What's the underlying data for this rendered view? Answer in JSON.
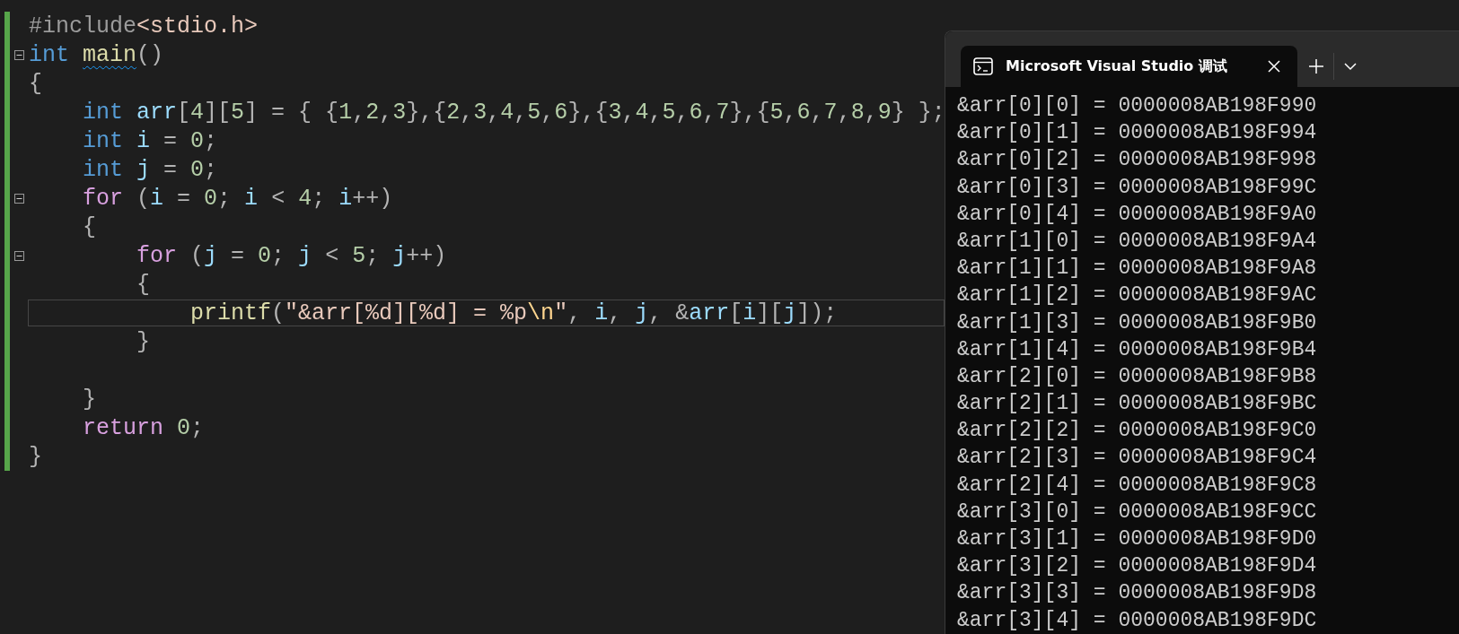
{
  "editor": {
    "lines": [
      {
        "tokens": [
          {
            "t": "#include",
            "kind": "pre"
          },
          {
            "t": "<stdio.h>",
            "kind": "inc"
          }
        ]
      },
      {
        "expanded": true,
        "tokens": [
          {
            "t": "int ",
            "kind": "kw"
          },
          {
            "t": "main",
            "kind": "fn",
            "error": true
          },
          {
            "t": "()",
            "kind": "p"
          }
        ]
      },
      {
        "tokens": [
          {
            "t": "{",
            "kind": "p"
          }
        ]
      },
      {
        "tokens": [
          {
            "t": "    int ",
            "kind": "kw"
          },
          {
            "t": "arr",
            "kind": "var"
          },
          {
            "t": "[",
            "kind": "p"
          },
          {
            "t": "4",
            "kind": "num"
          },
          {
            "t": "][",
            "kind": "p"
          },
          {
            "t": "5",
            "kind": "num"
          },
          {
            "t": "] = { {",
            "kind": "p"
          },
          {
            "t": "1",
            "kind": "num"
          },
          {
            "t": ",",
            "kind": "p"
          },
          {
            "t": "2",
            "kind": "num"
          },
          {
            "t": ",",
            "kind": "p"
          },
          {
            "t": "3",
            "kind": "num"
          },
          {
            "t": "},{",
            "kind": "p"
          },
          {
            "t": "2",
            "kind": "num"
          },
          {
            "t": ",",
            "kind": "p"
          },
          {
            "t": "3",
            "kind": "num"
          },
          {
            "t": ",",
            "kind": "p"
          },
          {
            "t": "4",
            "kind": "num"
          },
          {
            "t": ",",
            "kind": "p"
          },
          {
            "t": "5",
            "kind": "num"
          },
          {
            "t": ",",
            "kind": "p"
          },
          {
            "t": "6",
            "kind": "num"
          },
          {
            "t": "},{",
            "kind": "p"
          },
          {
            "t": "3",
            "kind": "num"
          },
          {
            "t": ",",
            "kind": "p"
          },
          {
            "t": "4",
            "kind": "num"
          },
          {
            "t": ",",
            "kind": "p"
          },
          {
            "t": "5",
            "kind": "num"
          },
          {
            "t": ",",
            "kind": "p"
          },
          {
            "t": "6",
            "kind": "num"
          },
          {
            "t": ",",
            "kind": "p"
          },
          {
            "t": "7",
            "kind": "num"
          },
          {
            "t": "},{",
            "kind": "p"
          },
          {
            "t": "5",
            "kind": "num"
          },
          {
            "t": ",",
            "kind": "p"
          },
          {
            "t": "6",
            "kind": "num"
          },
          {
            "t": ",",
            "kind": "p"
          },
          {
            "t": "7",
            "kind": "num"
          },
          {
            "t": ",",
            "kind": "p"
          },
          {
            "t": "8",
            "kind": "num"
          },
          {
            "t": ",",
            "kind": "p"
          },
          {
            "t": "9",
            "kind": "num"
          },
          {
            "t": "} };",
            "kind": "p"
          }
        ]
      },
      {
        "tokens": [
          {
            "t": "    int ",
            "kind": "kw"
          },
          {
            "t": "i",
            "kind": "var"
          },
          {
            "t": " = ",
            "kind": "p"
          },
          {
            "t": "0",
            "kind": "num"
          },
          {
            "t": ";",
            "kind": "p"
          }
        ]
      },
      {
        "tokens": [
          {
            "t": "    int ",
            "kind": "kw"
          },
          {
            "t": "j",
            "kind": "var"
          },
          {
            "t": " = ",
            "kind": "p"
          },
          {
            "t": "0",
            "kind": "num"
          },
          {
            "t": ";",
            "kind": "p"
          }
        ]
      },
      {
        "expanded": true,
        "tokens": [
          {
            "t": "    for",
            "kind": "ctl"
          },
          {
            "t": " (",
            "kind": "p"
          },
          {
            "t": "i",
            "kind": "var"
          },
          {
            "t": " = ",
            "kind": "p"
          },
          {
            "t": "0",
            "kind": "num"
          },
          {
            "t": "; ",
            "kind": "p"
          },
          {
            "t": "i",
            "kind": "var"
          },
          {
            "t": " < ",
            "kind": "p"
          },
          {
            "t": "4",
            "kind": "num"
          },
          {
            "t": "; ",
            "kind": "p"
          },
          {
            "t": "i",
            "kind": "var"
          },
          {
            "t": "++)",
            "kind": "p"
          }
        ]
      },
      {
        "tokens": [
          {
            "t": "    {",
            "kind": "p"
          }
        ]
      },
      {
        "expanded": true,
        "tokens": [
          {
            "t": "        for",
            "kind": "ctl"
          },
          {
            "t": " (",
            "kind": "p"
          },
          {
            "t": "j",
            "kind": "var"
          },
          {
            "t": " = ",
            "kind": "p"
          },
          {
            "t": "0",
            "kind": "num"
          },
          {
            "t": "; ",
            "kind": "p"
          },
          {
            "t": "j",
            "kind": "var"
          },
          {
            "t": " < ",
            "kind": "p"
          },
          {
            "t": "5",
            "kind": "num"
          },
          {
            "t": "; ",
            "kind": "p"
          },
          {
            "t": "j",
            "kind": "var"
          },
          {
            "t": "++)",
            "kind": "p"
          }
        ]
      },
      {
        "tokens": [
          {
            "t": "        {",
            "kind": "p"
          }
        ]
      },
      {
        "current": true,
        "tokens": [
          {
            "t": "            printf",
            "kind": "fn"
          },
          {
            "t": "(",
            "kind": "p"
          },
          {
            "t": "\"&arr[%d][%d] = %p",
            "kind": "str"
          },
          {
            "t": "\\n",
            "kind": "esc"
          },
          {
            "t": "\"",
            "kind": "str"
          },
          {
            "t": ", ",
            "kind": "p"
          },
          {
            "t": "i",
            "kind": "var"
          },
          {
            "t": ", ",
            "kind": "p"
          },
          {
            "t": "j",
            "kind": "var"
          },
          {
            "t": ", &",
            "kind": "p"
          },
          {
            "t": "arr",
            "kind": "var"
          },
          {
            "t": "[",
            "kind": "p"
          },
          {
            "t": "i",
            "kind": "var"
          },
          {
            "t": "][",
            "kind": "p"
          },
          {
            "t": "j",
            "kind": "var"
          },
          {
            "t": "]);",
            "kind": "p"
          }
        ]
      },
      {
        "tokens": [
          {
            "t": "        }",
            "kind": "p"
          }
        ]
      },
      {
        "current": false
      },
      {
        "tokens": [
          {
            "t": "    }",
            "kind": "p"
          }
        ]
      },
      {
        "tokens": [
          {
            "t": "    return ",
            "kind": "ctl"
          },
          {
            "t": "0",
            "kind": "num"
          },
          {
            "t": ";",
            "kind": "p"
          }
        ]
      },
      {
        "tokens": [
          {
            "t": "}",
            "kind": "p"
          }
        ]
      }
    ]
  },
  "terminal": {
    "tab": {
      "title": "Microsoft Visual Studio 调试",
      "selected": true
    },
    "output": [
      "&arr[0][0] = 0000008AB198F990",
      "&arr[0][1] = 0000008AB198F994",
      "&arr[0][2] = 0000008AB198F998",
      "&arr[0][3] = 0000008AB198F99C",
      "&arr[0][4] = 0000008AB198F9A0",
      "&arr[1][0] = 0000008AB198F9A4",
      "&arr[1][1] = 0000008AB198F9A8",
      "&arr[1][2] = 0000008AB198F9AC",
      "&arr[1][3] = 0000008AB198F9B0",
      "&arr[1][4] = 0000008AB198F9B4",
      "&arr[2][0] = 0000008AB198F9B8",
      "&arr[2][1] = 0000008AB198F9BC",
      "&arr[2][2] = 0000008AB198F9C0",
      "&arr[2][3] = 0000008AB198F9C4",
      "&arr[2][4] = 0000008AB198F9C8",
      "&arr[3][0] = 0000008AB198F9CC",
      "&arr[3][1] = 0000008AB198F9D0",
      "&arr[3][2] = 0000008AB198F9D4",
      "&arr[3][3] = 0000008AB198F9D8",
      "&arr[3][4] = 0000008AB198F9DC"
    ]
  }
}
